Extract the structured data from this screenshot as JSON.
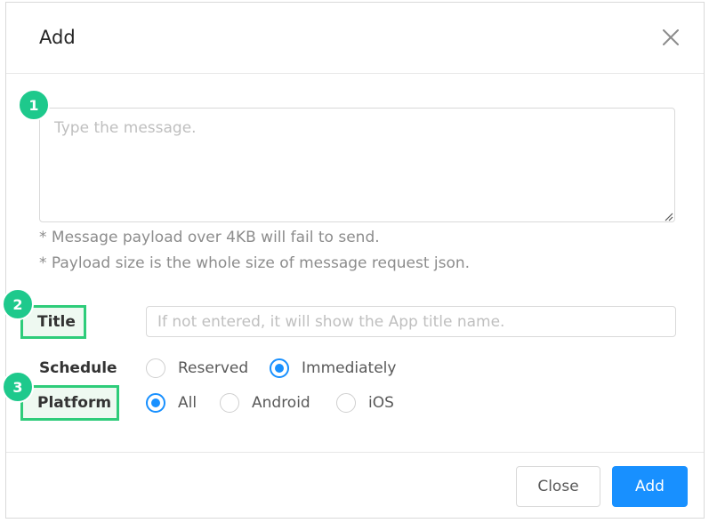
{
  "dialog": {
    "title": "Add",
    "message": {
      "placeholder": "Type the message.",
      "value": ""
    },
    "notes": [
      "* Message payload over 4KB will fail to send.",
      "* Payload size is the whole size of message request json."
    ],
    "title_field": {
      "label": "Title",
      "placeholder": "If not entered, it will show the App title name.",
      "value": ""
    },
    "schedule": {
      "label": "Schedule",
      "options": [
        "Reserved",
        "Immediately"
      ],
      "selected": "Immediately"
    },
    "platform": {
      "label": "Platform",
      "options": [
        "All",
        "Android",
        "iOS"
      ],
      "selected": "All"
    },
    "buttons": {
      "close": "Close",
      "add": "Add"
    }
  },
  "annotations": [
    "1",
    "2",
    "3"
  ],
  "colors": {
    "accent": "#1890ff",
    "annotation": "#1ec98c",
    "highlight_border": "#2ecc7a"
  }
}
